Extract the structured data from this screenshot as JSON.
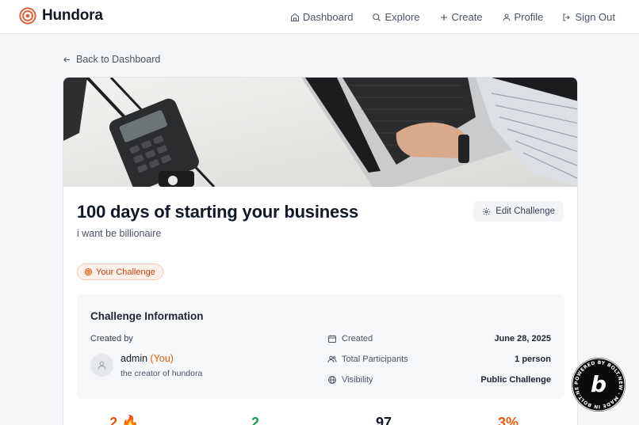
{
  "app": {
    "name": "Hundora"
  },
  "nav": {
    "dashboard": "Dashboard",
    "explore": "Explore",
    "create": "Create",
    "profile": "Profile",
    "sign_out": "Sign Out"
  },
  "back_link": "Back to Dashboard",
  "challenge": {
    "title": "100 days of starting your business",
    "description": "i want be billionaire",
    "edit_label": "Edit Challenge",
    "badge": "Your Challenge"
  },
  "info": {
    "heading": "Challenge Information",
    "created_by_label": "Created by",
    "creator_name": "admin",
    "creator_you": "(You)",
    "creator_desc": "the creator of hundora",
    "rows": [
      {
        "icon": "calendar-icon",
        "label": "Created",
        "value": "June 28, 2025"
      },
      {
        "icon": "users-icon",
        "label": "Total Participants",
        "value": "1 person"
      },
      {
        "icon": "globe-icon",
        "label": "Visibility",
        "value": "Public Challenge"
      }
    ]
  },
  "stats": [
    {
      "value": "2 🔥",
      "color": "#ea580c"
    },
    {
      "value": "2",
      "color": "#16a34a"
    },
    {
      "value": "97",
      "color": "#111827"
    },
    {
      "value": "3%",
      "color": "#ea580c"
    }
  ],
  "bolt_badge": {
    "text": "POWERED BY BOLT.NEW · MADE IN BOLT.NEW ·",
    "letter": "b"
  },
  "colors": {
    "accent": "#ea580c",
    "brand": "#e2613a"
  }
}
